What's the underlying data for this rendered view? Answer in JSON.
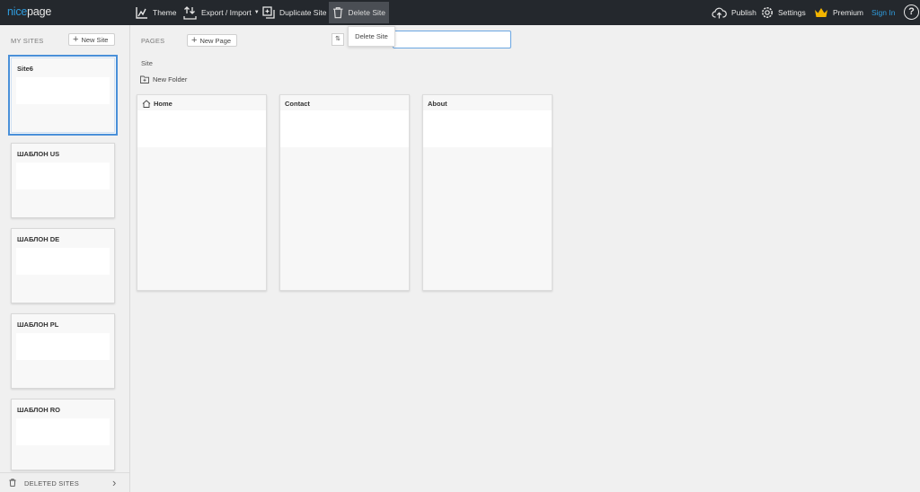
{
  "app": {
    "logo_part1": "nice",
    "logo_part2": "page"
  },
  "toolbar": {
    "theme": "Theme",
    "export_import": "Export / Import",
    "duplicate_site": "Duplicate Site",
    "delete_site": "Delete Site",
    "publish": "Publish",
    "settings": "Settings",
    "premium": "Premium",
    "sign_in": "Sign In",
    "help": "?"
  },
  "sidebar": {
    "heading": "MY SITES",
    "new_site_label": "New Site",
    "sites": [
      {
        "name": "Site6",
        "selected": true
      },
      {
        "name": "ШАБЛОН US"
      },
      {
        "name": "ШАБЛОН DE"
      },
      {
        "name": "ШАБЛОН PL"
      },
      {
        "name": "ШАБЛОН RO"
      }
    ],
    "deleted_sites_label": "DELETED SITES"
  },
  "main": {
    "heading": "PAGES",
    "new_page_label": "New Page",
    "tooltip": "Delete Site",
    "search": {
      "value": "",
      "placeholder": ""
    },
    "breadcrumb": "Site",
    "new_folder_label": "New Folder",
    "pages": [
      {
        "name": "Home",
        "icon": "home-icon"
      },
      {
        "name": "Contact"
      },
      {
        "name": "About"
      }
    ]
  },
  "colors": {
    "accent": "#2f9bdc",
    "topbar": "#24282d",
    "premium_crown": "#f2b400",
    "selection": "#4a90d9"
  }
}
